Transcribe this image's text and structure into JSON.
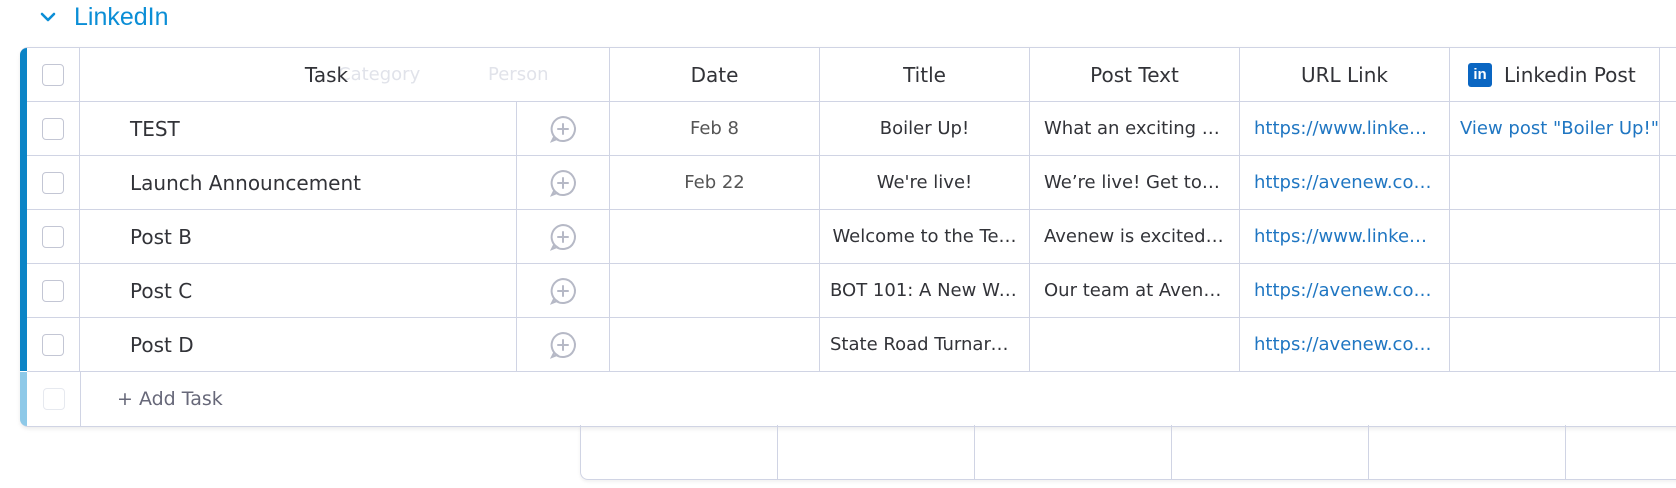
{
  "group": {
    "title": "LinkedIn"
  },
  "columns": {
    "task": "Task",
    "ghost_category": "Category",
    "ghost_person": "Person",
    "date": "Date",
    "title": "Title",
    "post_text": "Post Text",
    "url": "URL Link",
    "linkedin": "Linkedin Post"
  },
  "rows": [
    {
      "task": "TEST",
      "date": "Feb 8",
      "title": "Boiler Up!",
      "post_text": "What an exciting ti…",
      "url": "https://www.linkedi…",
      "linkedin": "View post \"Boiler Up!\""
    },
    {
      "task": "Launch Announcement",
      "date": "Feb 22",
      "title": "We're live!",
      "post_text": "We’re live! Get to k…",
      "url": "https://avenew.com/",
      "linkedin": ""
    },
    {
      "task": "Post B",
      "date": "",
      "title": "Welcome to the Te…",
      "post_text": "Avenew is excited t…",
      "url": "https://www.linkedi…",
      "linkedin": ""
    },
    {
      "task": "Post C",
      "date": "",
      "title": "BOT 101: A New Wa…",
      "post_text": "Our team at Avene…",
      "url": "https://avenew.co…",
      "linkedin": ""
    },
    {
      "task": "Post D",
      "date": "",
      "title": "State Road Turnaro…",
      "post_text": "",
      "url": "https://avenew.co…",
      "linkedin": ""
    }
  ],
  "add_task": "+ Add Task",
  "icons": {
    "collapse": "chevron-down-icon",
    "person": "add-person-icon",
    "linkedin": "linkedin-icon"
  },
  "colors": {
    "accent": "#0b84c6",
    "link": "#1f76c2",
    "linkedin": "#0a66c2"
  }
}
